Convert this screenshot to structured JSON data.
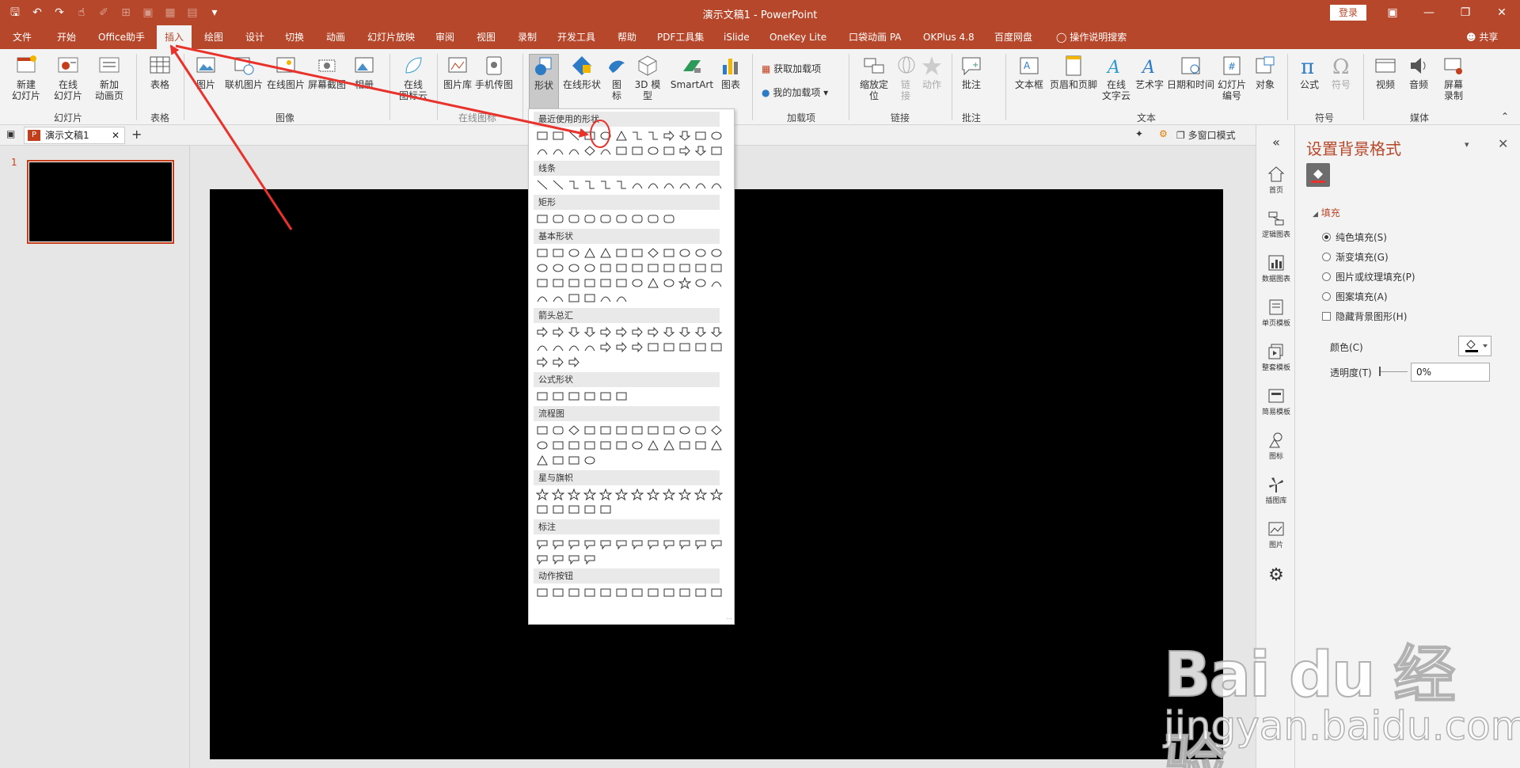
{
  "window": {
    "title": "演示文稿1  -  PowerPoint",
    "login": "登录",
    "share": "共享"
  },
  "tabs": [
    "文件",
    "开始",
    "Office助手",
    "插入",
    "绘图",
    "设计",
    "切换",
    "动画",
    "幻灯片放映",
    "审阅",
    "视图",
    "录制",
    "开发工具",
    "帮助",
    "PDF工具集",
    "iSlide",
    "OneKey Lite",
    "口袋动画 PA",
    "OKPlus 4.8",
    "百度网盘",
    "操作说明搜索"
  ],
  "active_tab": "插入",
  "ribbon": {
    "new_slide": "新建\n幻灯片",
    "online_slide": "在线\n幻灯片",
    "add_anim_page": "新加\n动画页",
    "table": "表格",
    "picture": "图片",
    "online_picture": "联机图片",
    "online_image": "在线图片",
    "screenshot": "屏幕截图",
    "album": "相册",
    "online_icon": "在线\n图标云",
    "gallery": "图片库",
    "phone_pic": "手机传图",
    "shapes": "形状",
    "online_shapes": "在线形状",
    "icons": "图\n标",
    "model3d": "3D 模\n型",
    "smartart": "SmartArt",
    "chart": "图表",
    "get_addins": "获取加载项",
    "my_addins": "我的加载项",
    "zoom": "缩放定\n位",
    "link": "链\n接",
    "action": "动作",
    "comment": "批注",
    "textbox": "文本框",
    "header_footer": "页眉和页脚",
    "online_text": "在线\n文字云",
    "wordart": "艺术字",
    "datetime": "日期和时间",
    "slide_num": "幻灯片\n编号",
    "object": "对象",
    "equation": "公式",
    "symbol": "符号",
    "video": "视频",
    "audio": "音频",
    "screen_rec": "屏幕\n录制",
    "groups": {
      "slides": "幻灯片",
      "table": "表格",
      "images": "图像",
      "online_icons": "在线图标",
      "addins": "加载项",
      "links": "链接",
      "comments": "批注",
      "text": "文本",
      "symbols": "符号",
      "media": "媒体"
    }
  },
  "doc_tab": {
    "name": "演示文稿1",
    "multi_window": "多窗口模式",
    "add": "+"
  },
  "thumbnails": [
    {
      "number": "1"
    }
  ],
  "shapes_gallery": {
    "sections": [
      "最近使用的形状",
      "线条",
      "矩形",
      "基本形状",
      "箭头总汇",
      "公式形状",
      "流程图",
      "星与旗帜",
      "标注",
      "动作按钮"
    ],
    "counts": [
      24,
      12,
      9,
      42,
      27,
      6,
      28,
      17,
      16,
      12
    ]
  },
  "sidebar": [
    "首页",
    "逻辑图表",
    "数据图表",
    "单页模板",
    "整套模板",
    "简易模板",
    "图标",
    "插图库",
    "图片"
  ],
  "format_pane": {
    "title": "设置背景格式",
    "section": "填充",
    "options": [
      "纯色填充(S)",
      "渐变填充(G)",
      "图片或纹理填充(P)",
      "图案填充(A)"
    ],
    "selected_option": 0,
    "hide_bg": "隐藏背景图形(H)",
    "color_label": "颜色(C)",
    "transparency_label": "透明度(T)",
    "transparency_value": "0%"
  },
  "watermark": {
    "main": "Bai du 经验",
    "sub": "jingyan.baidu.com"
  },
  "colors": {
    "accent": "#b7472a",
    "annotation": "#e8322b"
  }
}
